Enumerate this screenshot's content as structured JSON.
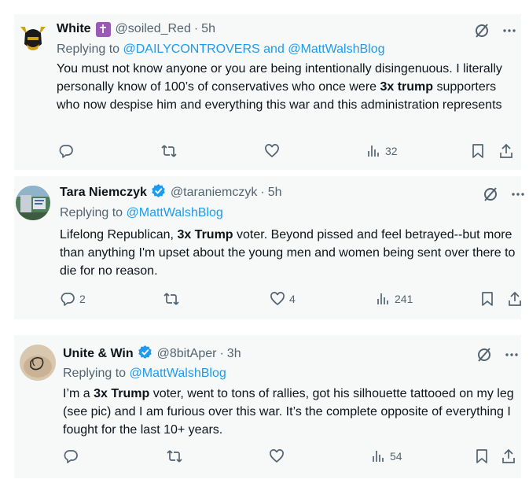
{
  "tweets": [
    {
      "name": "White",
      "badge_emoji": "✝",
      "handle": "@soiled_Red",
      "dot": "·",
      "time": "5h",
      "replying_prefix": "Replying to",
      "replying_to": "@DAILYCONTROVERS and @MattWalshBlog",
      "text_1": "You must not know anyone or you are being intentionally disingenuous. I literally personally know of 100’s of conservatives who once were ",
      "text_bold": "3x trump",
      "text_2": " supporters who now despise him and everything this war and this administration represents",
      "replies": "",
      "reposts": "",
      "likes": "",
      "views": "32"
    },
    {
      "name": "Tara Niemczyk",
      "verified": true,
      "handle": "@taraniemczyk",
      "dot": "·",
      "time": "5h",
      "replying_prefix": "Replying to",
      "replying_to": "@MattWalshBlog",
      "text_1": "Lifelong Republican, ",
      "text_bold": "3x Trump",
      "text_2": " voter.  Beyond pissed and feel betrayed--but more than anything I'm upset about the young men and women being sent over there to die for no reason.",
      "replies": "2",
      "reposts": "",
      "likes": "4",
      "views": "241"
    },
    {
      "name": "Unite & Win",
      "verified": true,
      "handle": "@8bitAper",
      "dot": "·",
      "time": "3h",
      "replying_prefix": "Replying to",
      "replying_to": "@MattWalshBlog",
      "text_1": "I’m a ",
      "text_bold": "3x Trump",
      "text_2": " voter, went to tons of rallies, got his silhouette tattooed on my leg (see pic) and I am furious over this war. It’s the complete opposite of everything I fought for the last 10+ years.",
      "replies": "",
      "reposts": "",
      "likes": "",
      "views": "54"
    }
  ],
  "colors": {
    "card_bg": "#f7f9f9",
    "link": "#1d9bf0",
    "secondary": "#536471",
    "verified": "#1d9bf0",
    "badge_bg": "#9b59b6"
  },
  "icons": [
    "grok-icon",
    "more-icon",
    "reply-icon",
    "repost-icon",
    "like-icon",
    "views-icon",
    "bookmark-icon",
    "share-icon"
  ]
}
